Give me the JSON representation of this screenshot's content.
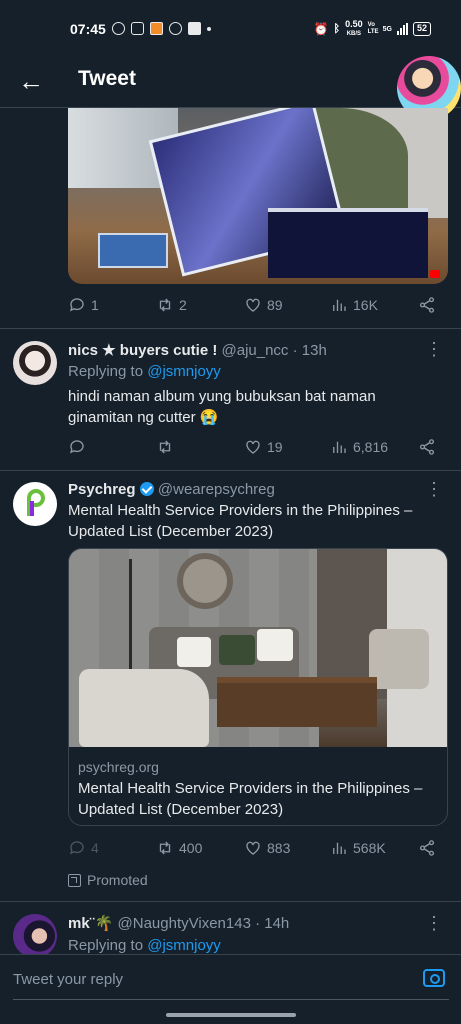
{
  "status_bar": {
    "time": "07:45",
    "speed": "0.50",
    "speed_unit": "KB/S",
    "volte": "Vo LTE",
    "network": "5G",
    "battery": "52"
  },
  "header": {
    "title": "Tweet",
    "back_icon": "arrow-left-icon"
  },
  "tweets": [
    {
      "id": "t1",
      "stats": {
        "replies": "1",
        "retweets": "2",
        "likes": "89",
        "views": "16K"
      }
    },
    {
      "id": "t2",
      "display_name": "nics ★ buyers cutie !",
      "handle": "@aju_ncc",
      "time": "· 13h",
      "replying_prefix": "Replying to",
      "replying_to": "@jsmnjoyy",
      "text_line1": "hindi naman album yung bubuksan bat naman",
      "text_line2": "ginamitan ng cutter 😭",
      "stats": {
        "replies": "",
        "retweets": "",
        "likes": "19",
        "views": "6,816"
      }
    },
    {
      "id": "t3",
      "display_name": "Psychreg",
      "handle": "@wearepsychreg",
      "text_line1": "Mental Health Service Providers in the Philippines –",
      "text_line2": "Updated List (December 2023)",
      "card": {
        "domain": "psychreg.org",
        "title_line1": "Mental Health Service Providers in the Philippines –",
        "title_line2": "Updated List (December 2023)"
      },
      "stats": {
        "replies": "4",
        "retweets": "400",
        "likes": "883",
        "views": "568K"
      },
      "promoted": "Promoted"
    },
    {
      "id": "t4",
      "display_name": "mk¨🌴",
      "handle": "@NaughtyVixen143",
      "time": "· 14h",
      "replying_prefix": "Replying to",
      "replying_to": "@jsmnjoyy"
    }
  ],
  "reply": {
    "placeholder": "Tweet your reply"
  }
}
